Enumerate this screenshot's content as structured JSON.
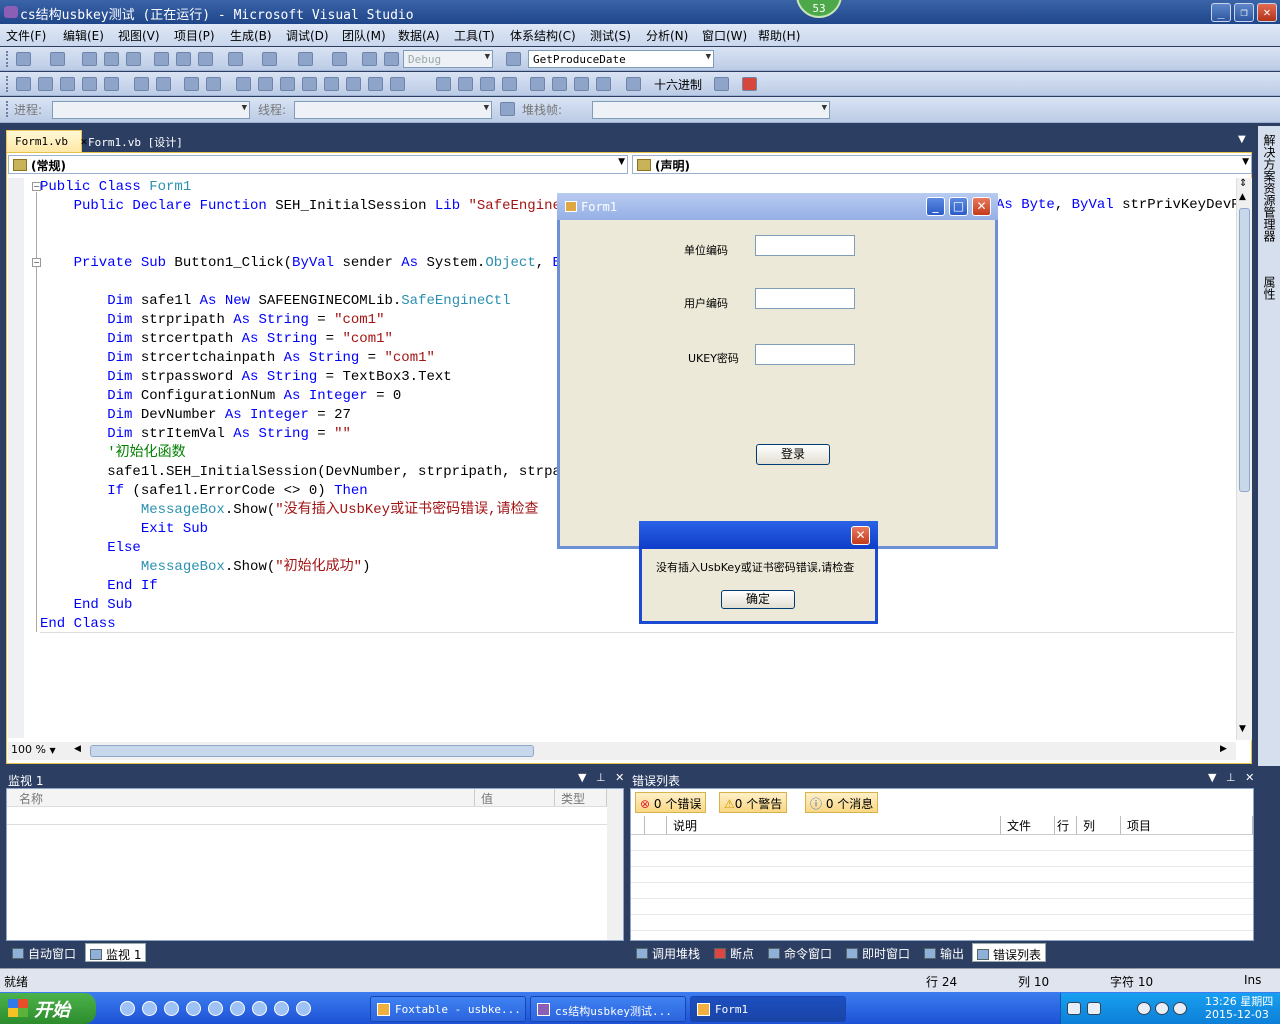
{
  "window": {
    "title": "cs结构usbkey测试 (正在运行) - Microsoft Visual Studio",
    "notification_count": "53"
  },
  "menu": [
    "文件(F)",
    "编辑(E)",
    "视图(V)",
    "项目(P)",
    "生成(B)",
    "调试(D)",
    "团队(M)",
    "数据(A)",
    "工具(T)",
    "体系结构(C)",
    "测试(S)",
    "分析(N)",
    "窗口(W)",
    "帮助(H)"
  ],
  "toolbar": {
    "config": "Debug",
    "find_combo": "GetProduceDate",
    "hex_label": "十六进制",
    "process_label": "进程:",
    "thread_label": "线程:",
    "stackframe_label": "堆栈帧:"
  },
  "tabs": [
    {
      "label": "Form1.vb",
      "active": true
    },
    {
      "label": "Form1.vb [设计]",
      "active": false
    }
  ],
  "editor": {
    "left_combo": "(常规)",
    "right_combo": "(声明)",
    "zoom": "100 %",
    "lines": [
      [
        {
          "t": "Public Class ",
          "c": "kw"
        },
        {
          "t": "Form1",
          "c": "ty"
        }
      ],
      [
        {
          "t": "    Public Declare Function ",
          "c": "kw"
        },
        {
          "t": "SEH_InitialSession ",
          "c": ""
        },
        {
          "t": "Lib ",
          "c": "kw"
        },
        {
          "t": "\"SafeEngineco",
          "c": "str"
        }
      ],
      [],
      [],
      [
        {
          "t": "    Private Sub ",
          "c": "kw"
        },
        {
          "t": "Button1_Click(",
          "c": ""
        },
        {
          "t": "ByVal ",
          "c": "kw"
        },
        {
          "t": "sender ",
          "c": ""
        },
        {
          "t": "As ",
          "c": "kw"
        },
        {
          "t": "System.",
          "c": ""
        },
        {
          "t": "Object",
          "c": "ty"
        },
        {
          "t": ", ",
          "c": ""
        },
        {
          "t": "ByV",
          "c": "kw"
        }
      ],
      [],
      [
        {
          "t": "        Dim ",
          "c": "kw"
        },
        {
          "t": "safe1l ",
          "c": ""
        },
        {
          "t": "As New ",
          "c": "kw"
        },
        {
          "t": "SAFEENGINECOMLib.",
          "c": ""
        },
        {
          "t": "SafeEngineCtl",
          "c": "ty"
        }
      ],
      [
        {
          "t": "        Dim ",
          "c": "kw"
        },
        {
          "t": "strpripath ",
          "c": ""
        },
        {
          "t": "As String ",
          "c": "kw"
        },
        {
          "t": "= ",
          "c": ""
        },
        {
          "t": "\"com1\"",
          "c": "str"
        }
      ],
      [
        {
          "t": "        Dim ",
          "c": "kw"
        },
        {
          "t": "strcertpath ",
          "c": ""
        },
        {
          "t": "As String ",
          "c": "kw"
        },
        {
          "t": "= ",
          "c": ""
        },
        {
          "t": "\"com1\"",
          "c": "str"
        }
      ],
      [
        {
          "t": "        Dim ",
          "c": "kw"
        },
        {
          "t": "strcertchainpath ",
          "c": ""
        },
        {
          "t": "As String ",
          "c": "kw"
        },
        {
          "t": "= ",
          "c": ""
        },
        {
          "t": "\"com1\"",
          "c": "str"
        }
      ],
      [
        {
          "t": "        Dim ",
          "c": "kw"
        },
        {
          "t": "strpassword ",
          "c": ""
        },
        {
          "t": "As String ",
          "c": "kw"
        },
        {
          "t": "= TextBox3.Text",
          "c": ""
        }
      ],
      [
        {
          "t": "        Dim ",
          "c": "kw"
        },
        {
          "t": "ConfigurationNum ",
          "c": ""
        },
        {
          "t": "As Integer ",
          "c": "kw"
        },
        {
          "t": "= 0",
          "c": ""
        }
      ],
      [
        {
          "t": "        Dim ",
          "c": "kw"
        },
        {
          "t": "DevNumber ",
          "c": ""
        },
        {
          "t": "As Integer ",
          "c": "kw"
        },
        {
          "t": "= 27",
          "c": ""
        }
      ],
      [
        {
          "t": "        Dim ",
          "c": "kw"
        },
        {
          "t": "strItemVal ",
          "c": ""
        },
        {
          "t": "As String ",
          "c": "kw"
        },
        {
          "t": "= ",
          "c": ""
        },
        {
          "t": "\"\"",
          "c": "str"
        }
      ],
      [
        {
          "t": "        '初始化函数",
          "c": "cm"
        }
      ],
      [
        {
          "t": "        safe1l.SEH_InitialSession(DevNumber, strpripath, strpass",
          "c": ""
        }
      ],
      [
        {
          "t": "        If ",
          "c": "kw"
        },
        {
          "t": "(safe1l.ErrorCode <> 0) ",
          "c": ""
        },
        {
          "t": "Then",
          "c": "kw"
        }
      ],
      [
        {
          "t": "            MessageBox",
          "c": "ty"
        },
        {
          "t": ".Show(",
          "c": ""
        },
        {
          "t": "\"没有插入UsbKey或证书密码错误,请检查",
          "c": "str"
        }
      ],
      [
        {
          "t": "            Exit Sub",
          "c": "kw"
        }
      ],
      [
        {
          "t": "        Else",
          "c": "kw"
        }
      ],
      [
        {
          "t": "            MessageBox",
          "c": "ty"
        },
        {
          "t": ".Show(",
          "c": ""
        },
        {
          "t": "\"初始化成功\"",
          "c": "str"
        },
        {
          "t": ")",
          "c": ""
        }
      ],
      [
        {
          "t": "        End If",
          "c": "kw"
        }
      ],
      [
        {
          "t": "    End Sub",
          "c": "kw"
        }
      ],
      [
        {
          "t": "End Class",
          "c": "kw"
        }
      ]
    ],
    "overflow_text": [
      {
        "t": "As ",
        "c": "kw"
      },
      {
        "t": "Byte",
        "c": "kw"
      },
      {
        "t": ", ",
        "c": ""
      },
      {
        "t": "ByVal ",
        "c": "kw"
      },
      {
        "t": "strPrivKeyDevPa",
        "c": ""
      }
    ]
  },
  "form1": {
    "title": "Form1",
    "label_unit": "单位编码",
    "label_user": "用户编码",
    "label_ukey": "UKEY密码",
    "login_button": "登录"
  },
  "msgbox": {
    "text": "没有插入UsbKey或证书密码错误,请检查",
    "ok_button": "确定"
  },
  "watch": {
    "title": "监视 1",
    "col_name": "名称",
    "col_value": "值",
    "col_type": "类型"
  },
  "errors": {
    "title": "错误列表",
    "errors_btn": "0 个错误",
    "warnings_btn": "0 个警告",
    "messages_btn": "0 个消息",
    "col_desc": "说明",
    "col_file": "文件",
    "col_line": "行",
    "col_col": "列",
    "col_project": "项目"
  },
  "bottom_tabs_left": [
    "自动窗口",
    "监视 1"
  ],
  "bottom_tabs_right": [
    "调用堆栈",
    "断点",
    "命令窗口",
    "即时窗口",
    "输出",
    "错误列表"
  ],
  "status": {
    "ready": "就绪",
    "line": "行 24",
    "col": "列 10",
    "char": "字符 10",
    "mode": "Ins"
  },
  "right_dock": [
    "解决方案资源管理器",
    "属性"
  ],
  "taskbar": {
    "start": "开始",
    "tasks": [
      "Foxtable - usbke...",
      "cs结构usbkey测试...",
      "Form1"
    ],
    "time": "13:26",
    "weekday": "星期四",
    "date": "2015-12-03"
  }
}
